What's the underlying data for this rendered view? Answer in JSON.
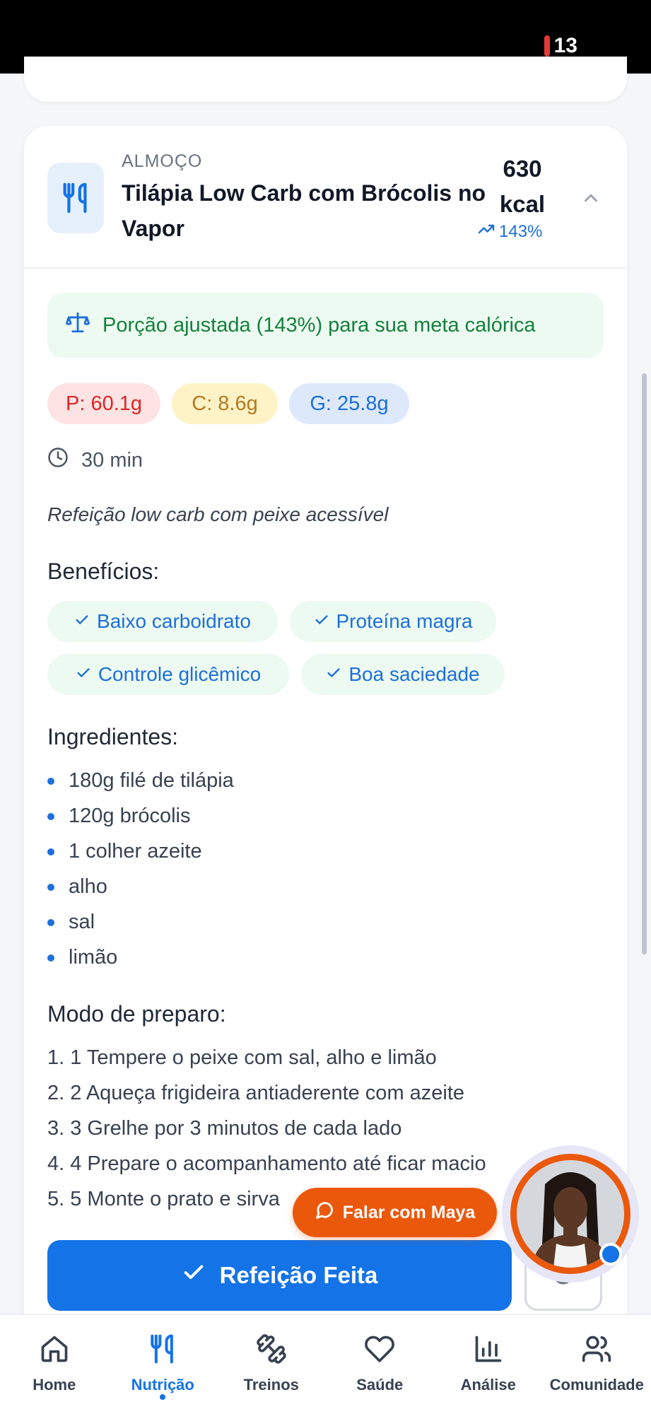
{
  "status_bar": {
    "battery": "13"
  },
  "meal": {
    "type": "ALMOÇO",
    "title": "Tilápia Low Carb com Brócolis no Vapor",
    "kcal_value": "630",
    "kcal_unit": "kcal",
    "percent": "143%",
    "portion_note": "Porção ajustada (143%) para sua meta calórica",
    "macros": {
      "protein": "P: 60.1g",
      "carbs": "C: 8.6g",
      "fat": "G: 25.8g"
    },
    "time": "30 min",
    "description": "Refeição low carb com peixe acessível",
    "benefits_title": "Benefícios:",
    "benefits": [
      "Baixo carboidrato",
      "Proteína magra",
      "Controle glicêmico",
      "Boa saciedade"
    ],
    "ingredients_title": "Ingredientes:",
    "ingredients": [
      "180g filé de tilápia",
      "120g brócolis",
      "1 colher azeite",
      "alho",
      "sal",
      "limão"
    ],
    "steps_title": "Modo de preparo:",
    "steps": [
      "1. 1 Tempere o peixe com sal, alho e limão",
      "2. 2 Aqueça frigideira antiaderente com azeite",
      "3. 3 Grelhe por 3 minutos de cada lado",
      "4. 4 Prepare o acompanhamento até ficar macio",
      "5. 5 Monte o prato e sirva"
    ],
    "done_label": "Refeição Feita"
  },
  "chat_button": "Falar com Maya",
  "nav": [
    "Home",
    "Nutrição",
    "Treinos",
    "Saúde",
    "Análise",
    "Comunidade"
  ],
  "active_nav": "Nutrição",
  "colors": {
    "primary": "#1473e6",
    "accent": "#ea580c",
    "success_bg": "#ecfaf1",
    "success_text": "#15803d"
  },
  "icons": {
    "meal": "utensils-icon",
    "collapse": "chevron-up-icon",
    "trend": "trending-up-icon",
    "scale": "scale-icon",
    "clock": "clock-icon",
    "check": "check-icon",
    "chat": "chat-bubble-icon",
    "redo": "refresh-icon",
    "nav": [
      "home-icon",
      "utensils-icon",
      "dumbbell-icon",
      "heart-icon",
      "bar-chart-icon",
      "users-icon"
    ]
  }
}
